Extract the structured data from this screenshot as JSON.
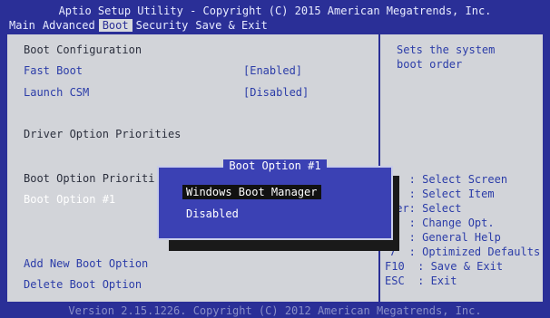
{
  "header": {
    "title": "Aptio Setup Utility - Copyright (C) 2015 American Megatrends, Inc.",
    "tabs": [
      "Main",
      "Advanced",
      "Boot",
      "Security",
      "Save & Exit"
    ],
    "active_tab": "Boot"
  },
  "left": {
    "section_title": "Boot Configuration",
    "fast_boot_label": "Fast Boot",
    "fast_boot_value": "[Enabled]",
    "launch_csm_label": "Launch CSM",
    "launch_csm_value": "[Disabled]",
    "driver_priorities": "Driver Option Priorities",
    "boot_priorities": "Boot Option Prioriti",
    "boot_option_1": "Boot Option #1",
    "add_new": "Add New Boot Option",
    "delete": "Delete Boot Option"
  },
  "right": {
    "help_line1": "Sets the system",
    "help_line2": "boot order",
    "keys": [
      "←  : Select Screen",
      "↑  : Select Item",
      "ter: Select",
      "-  : Change Opt.",
      "   : General Help",
      "7  : Optimized Defaults",
      "F10  : Save & Exit",
      "ESC  : Exit"
    ]
  },
  "modal": {
    "title": "Boot Option #1",
    "options": [
      "Windows Boot Manager",
      "Disabled"
    ],
    "selected_index": 0
  },
  "footer": {
    "text": "Version 2.15.1226. Copyright (C) 2012 American Megatrends, Inc."
  },
  "colors": {
    "background": "#2a2f97",
    "panel": "#d2d4d9",
    "modal": "#3b41b4",
    "link": "#2b3ca8"
  }
}
